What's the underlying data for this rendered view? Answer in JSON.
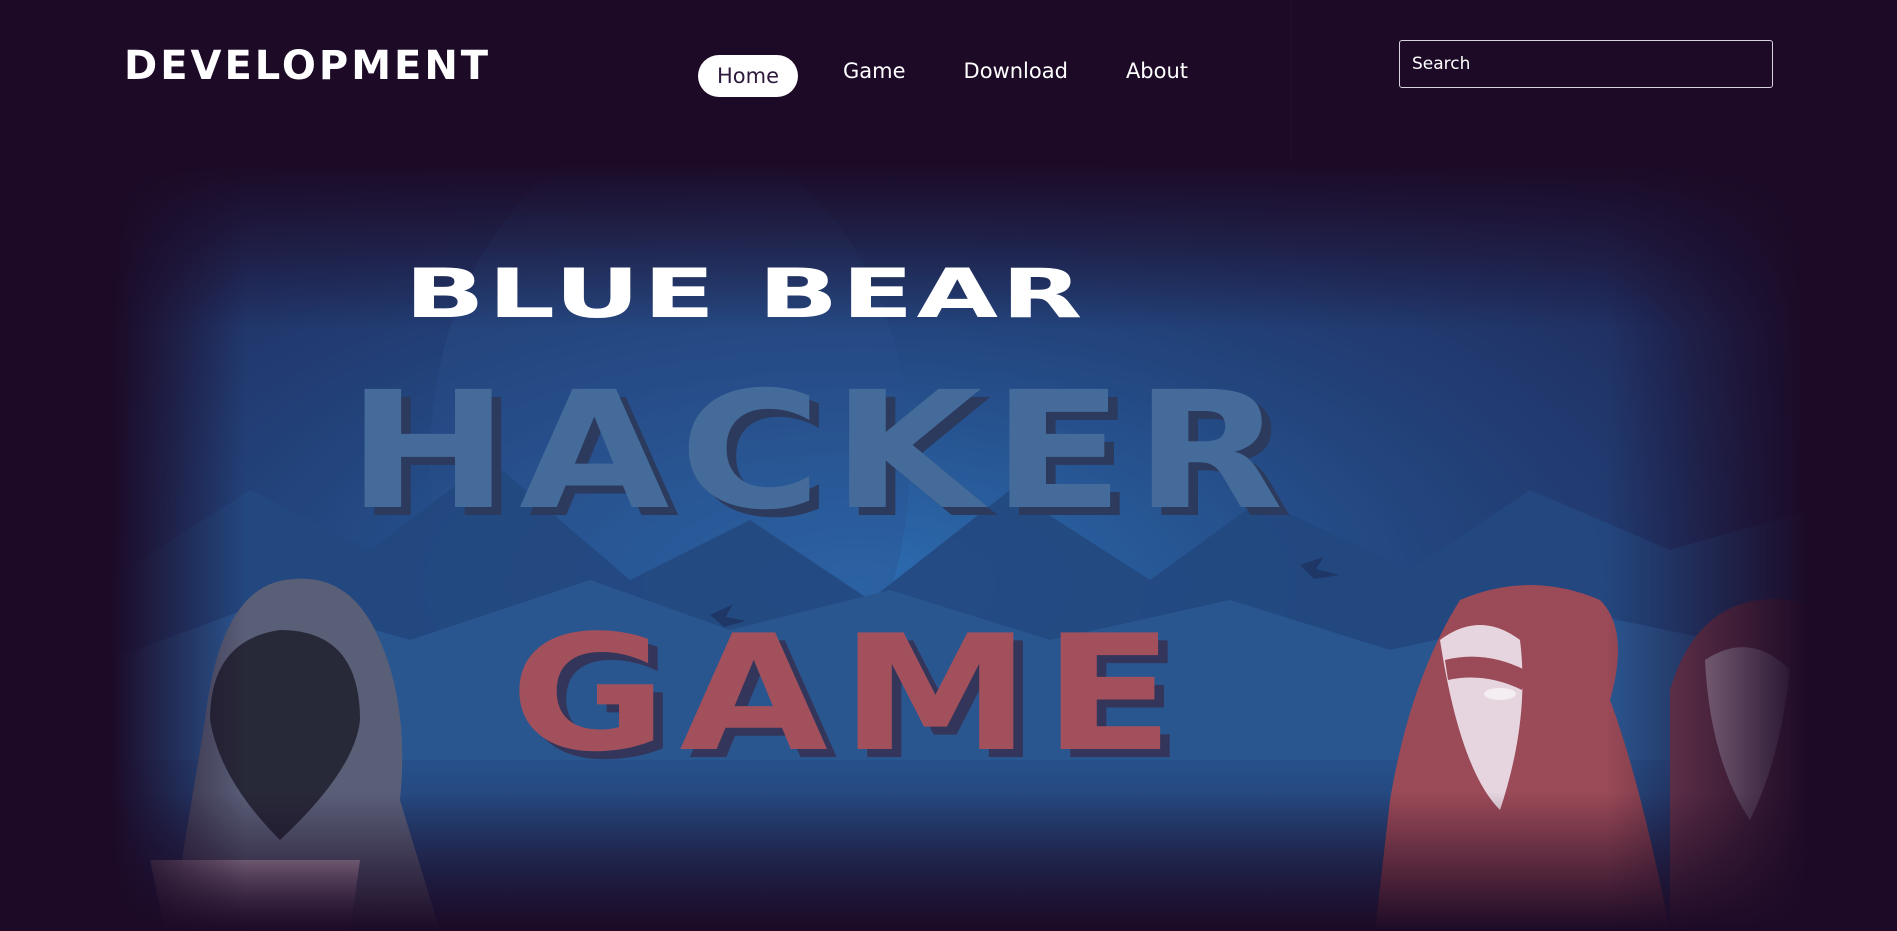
{
  "header": {
    "logo": "DEVELOPMENT",
    "nav": [
      {
        "label": "Home",
        "active": true
      },
      {
        "label": "Game",
        "active": false
      },
      {
        "label": "Download",
        "active": false
      },
      {
        "label": "About",
        "active": false
      }
    ],
    "search": {
      "placeholder": "Search",
      "value": ""
    }
  },
  "hero": {
    "title_top": "BLUE BEAR",
    "title_middle": "HACKER",
    "title_bottom": "GAME"
  },
  "colors": {
    "page_background": "#1c0a26",
    "hero_blue": "#2a5a92",
    "hacker_text": "#456b9a",
    "game_text": "#a2505c",
    "figure_red": "#9b4a57",
    "figure_gray": "#5a5f78"
  }
}
